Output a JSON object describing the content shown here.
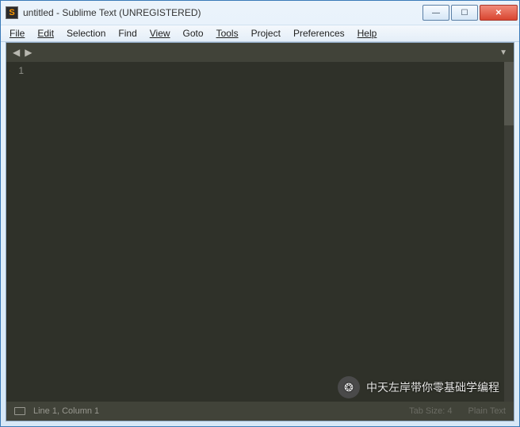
{
  "title": "untitled - Sublime Text (UNREGISTERED)",
  "menu": [
    "File",
    "Edit",
    "Selection",
    "Find",
    "View",
    "Goto",
    "Tools",
    "Project",
    "Preferences",
    "Help"
  ],
  "gutter": {
    "line1": "1"
  },
  "status": {
    "position": "Line 1, Column 1",
    "tabsize": "Tab Size: 4",
    "syntax": "Plain Text"
  },
  "watermark": {
    "text": "中天左岸带你零基础学编程",
    "icon": "❂"
  }
}
